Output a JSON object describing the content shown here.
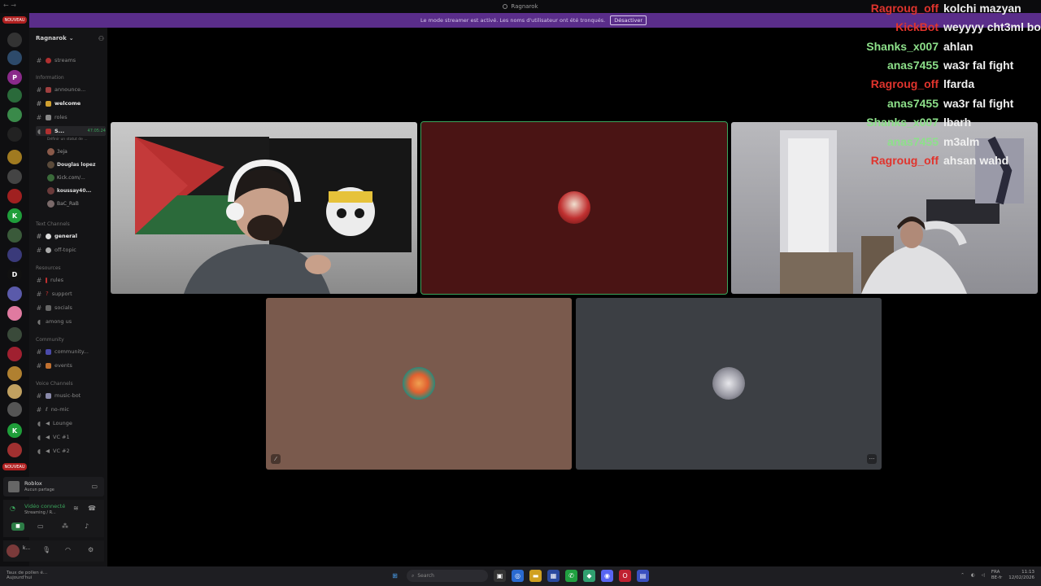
{
  "window": {
    "title": "Ragnarok"
  },
  "banner": {
    "text": "Le mode streamer est activé. Les noms d'utilisateur ont été tronqués.",
    "button": "Désactiver"
  },
  "rail": {
    "badge_top": "NOUVEAU",
    "badge_bottom": "NOUVEAU"
  },
  "server": {
    "name": "Ragnarok"
  },
  "categories": {
    "information": "Information",
    "text": "Text Channels",
    "resources": "Resources",
    "community": "Community",
    "voice": "Voice Channels"
  },
  "channels": {
    "streams": "streams",
    "announce": "announce...",
    "welcome": "welcome",
    "roles": "roles",
    "live_vc": "S...",
    "live_vc_time": "47:05:24",
    "live_vc_status": "Définir un statut de ...",
    "general": "general",
    "off_topic": "off-topic",
    "rules": "rules",
    "support": "support",
    "socials": "socials",
    "among_us": "among us",
    "community": "community...",
    "events": "events",
    "music_bot": "music-bot",
    "no_mic": "no-mic",
    "lounge": "Lounge",
    "vc1": "VC #1",
    "vc2": "VC #2"
  },
  "voice_users": [
    "3eja",
    "Douglas lopez",
    "Kick.com/...",
    "koussay40...",
    "BaC_RaB"
  ],
  "activity": {
    "game": "Roblox",
    "sub": "Aucun partage"
  },
  "voice_panel": {
    "status": "Vidéo connecté",
    "sub": "Streaming / R..."
  },
  "user_panel": {
    "name": "k..."
  },
  "chat": [
    {
      "name": "Ragroug_off",
      "message": "kolchi mazyan",
      "color": "#e0342d"
    },
    {
      "name": "KickBot",
      "message": "weyyyy cht3ml bo",
      "color": "#e0342d"
    },
    {
      "name": "Shanks_x007",
      "message": "ahlan",
      "color": "#8de08a"
    },
    {
      "name": "anas7455",
      "message": "wa3r fal fight",
      "color": "#8de08a"
    },
    {
      "name": "Ragroug_off",
      "message": "lfarda",
      "color": "#e0342d"
    },
    {
      "name": "anas7455",
      "message": "wa3r fal fight",
      "color": "#8de08a"
    },
    {
      "name": "Shanks_x007",
      "message": "lbarh",
      "color": "#8de08a"
    },
    {
      "name": "anas7455",
      "message": "m3alm",
      "color": "#8de08a"
    },
    {
      "name": "Ragroug_off",
      "message": "ahsan wahd",
      "color": "#e0342d"
    }
  ],
  "taskbar": {
    "weather": "Taux de pollen é...",
    "weather_sub": "Aujourd'hui",
    "search": "Search",
    "lang": "FRA",
    "lang_sub": "BE-fr",
    "time": "11:13",
    "date": "12/02/2026"
  },
  "colors": {
    "accent_green": "#3ba55c",
    "banner_purple": "#5a2d8a",
    "tile_red": "#4a1414",
    "tile_brown": "#7a5a4d",
    "tile_slate": "#3c3f44"
  }
}
